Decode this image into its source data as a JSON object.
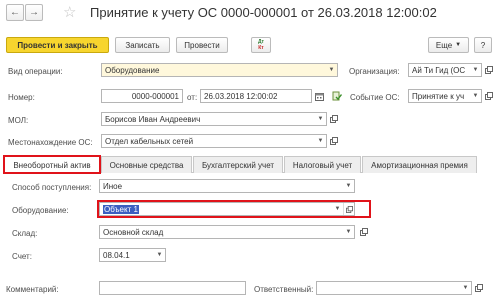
{
  "window": {
    "title": "Принятие к учету ОС 0000-000001 от 26.03.2018 12:00:02",
    "back_icon": "arrow-left-icon",
    "forward_icon": "arrow-right-icon",
    "favorite_icon": "star-icon"
  },
  "toolbar": {
    "post_close_label": "Провести и закрыть",
    "save_label": "Записать",
    "post_label": "Провести",
    "dt_kt_label_top": "Дт",
    "dt_kt_label_bottom": "Кт",
    "more_label": "Еще",
    "help_label": "?"
  },
  "header": {
    "operation_label": "Вид операции:",
    "operation_value": "Оборудование",
    "org_label": "Организация:",
    "org_value": "Ай Ти Гид (ОС",
    "number_label": "Номер:",
    "number_value": "0000-000001",
    "date_label": "от:",
    "date_value": "26.03.2018 12:00:02",
    "event_label": "Событие ОС:",
    "event_value": "Принятие к уч",
    "mol_label": "МОЛ:",
    "mol_value": "Борисов Иван Андреевич",
    "location_label": "Местонахождение ОС:",
    "location_value": "Отдел кабельных сетей"
  },
  "tabs": [
    {
      "label": "Внеоборотный актив"
    },
    {
      "label": "Основные средства"
    },
    {
      "label": "Бухгалтерский учет"
    },
    {
      "label": "Налоговый учет"
    },
    {
      "label": "Амортизационная премия"
    }
  ],
  "tab_content": {
    "method_label": "Способ поступления:",
    "method_value": "Иное",
    "equipment_label": "Оборудование:",
    "equipment_value": "Объект 1",
    "warehouse_label": "Склад:",
    "warehouse_value": "Основной склад",
    "account_label": "Счет:",
    "account_value": "08.04.1"
  },
  "footer": {
    "comment_label": "Комментарий:",
    "comment_value": "",
    "responsible_label": "Ответственный:",
    "responsible_value": ""
  },
  "colors": {
    "primary_button": "#f7d52e",
    "highlight": "#e0131a",
    "selection": "#3b5ec0",
    "yellow_field": "#fff8dc"
  }
}
